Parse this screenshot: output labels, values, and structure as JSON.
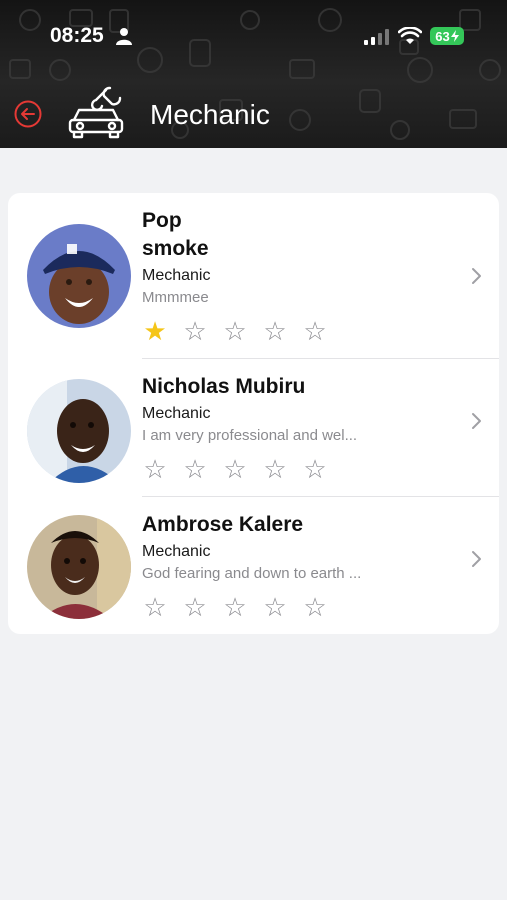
{
  "status_bar": {
    "time": "08:25",
    "battery": "63",
    "icons": [
      "person-icon",
      "cellular-signal-icon",
      "wifi-icon",
      "battery-charging-icon"
    ]
  },
  "header": {
    "title": "Mechanic",
    "back_icon": "back-arrow-icon",
    "category_icon": "car-wrench-icon"
  },
  "colors": {
    "header_bg": "#1e1e1e",
    "back_accent": "#e53935",
    "star_filled": "#f5c518",
    "battery": "#34c759",
    "page_bg": "#f1f2f4"
  },
  "mechanics": [
    {
      "name_line1": "Pop",
      "name_line2": "smoke",
      "role": "Mechanic",
      "bio": "Mmmmee",
      "rating": 1,
      "max_rating": 5
    },
    {
      "name": "Nicholas Mubiru",
      "role": "Mechanic",
      "bio": "I am very professional and wel...",
      "rating": 0,
      "max_rating": 5
    },
    {
      "name": "Ambrose Kalere",
      "role": "Mechanic",
      "bio": "God fearing and down to earth ...",
      "rating": 0,
      "max_rating": 5
    }
  ]
}
